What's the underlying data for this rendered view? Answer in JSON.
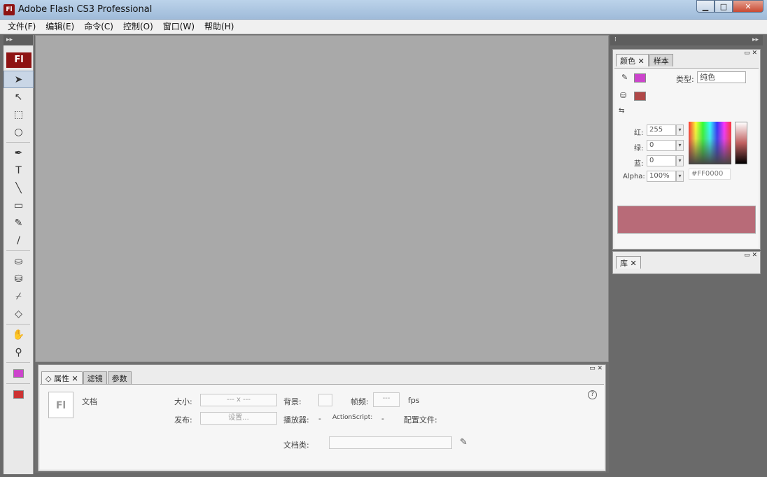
{
  "window": {
    "title": "Adobe Flash CS3 Professional",
    "app_icon_text": "Fl",
    "buttons": {
      "minimize": "▁",
      "maximize": "□",
      "close": "✕"
    }
  },
  "menubar": {
    "items": [
      "文件(F)",
      "编辑(E)",
      "命令(C)",
      "控制(O)",
      "窗口(W)",
      "帮助(H)"
    ]
  },
  "tools": {
    "header": "▸▸",
    "logo": "Fl",
    "items": [
      {
        "name": "selection-tool",
        "glyph": "➤"
      },
      {
        "name": "subselection-tool",
        "glyph": "↖"
      },
      {
        "name": "free-transform-tool",
        "glyph": "⬚"
      },
      {
        "name": "lasso-tool",
        "glyph": "○"
      },
      {
        "name": "pen-tool",
        "glyph": "✒"
      },
      {
        "name": "text-tool",
        "glyph": "T"
      },
      {
        "name": "line-tool",
        "glyph": "╲"
      },
      {
        "name": "rectangle-tool",
        "glyph": "▭"
      },
      {
        "name": "pencil-tool",
        "glyph": "✎"
      },
      {
        "name": "brush-tool",
        "glyph": "∕"
      },
      {
        "name": "ink-bottle-tool",
        "glyph": "⛀"
      },
      {
        "name": "paint-bucket-tool",
        "glyph": "⛁"
      },
      {
        "name": "eyedropper-tool",
        "glyph": "⌿"
      },
      {
        "name": "eraser-tool",
        "glyph": "◇"
      },
      {
        "name": "hand-tool",
        "glyph": "✋"
      },
      {
        "name": "zoom-tool",
        "glyph": "⚲"
      }
    ]
  },
  "properties": {
    "tabs": [
      "◇ 属性 ✕",
      "滤镜",
      "参数"
    ],
    "doc_label": "文档",
    "doc_icon": "Fl",
    "size_label": "大小:",
    "size_value": "--- x ---",
    "background_label": "背景:",
    "framerate_label": "帧频:",
    "framerate_value": "---",
    "fps": "fps",
    "publish_label": "发布:",
    "settings_button": "设置...",
    "player_label": "播放器:",
    "player_value": "-",
    "actionscript_label": "ActionScript:",
    "actionscript_value": "-",
    "profile_label": "配置文件:",
    "doc_class_label": "文档类:",
    "help": "?",
    "controls": "▭ ✕"
  },
  "color_panel": {
    "tabs": [
      "颜色 ✕",
      "样本"
    ],
    "type_label": "类型:",
    "type_value": "纯色",
    "red_label": "红:",
    "red_value": "255",
    "green_label": "绿:",
    "green_value": "0",
    "blue_label": "蓝:",
    "blue_value": "0",
    "alpha_label": "Alpha:",
    "alpha_value": "100%",
    "hex_value": "#FF0000",
    "controls": "▭ ✕",
    "stroke_color": "#cc44cc",
    "fill_color": "#b04848",
    "preview_color": "#b86b78"
  },
  "library_panel": {
    "tabs": [
      "库 ✕"
    ],
    "controls": "▭ ✕"
  }
}
